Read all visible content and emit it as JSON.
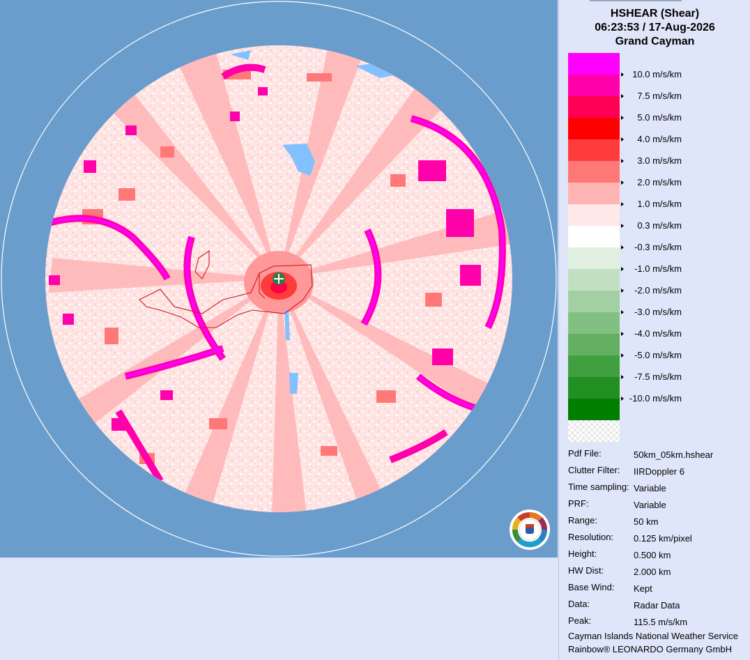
{
  "product": {
    "title": "HSHEAR (Shear)",
    "datetime": "06:23:53 / 17-Aug-2026",
    "site": "Grand Cayman"
  },
  "legend": [
    {
      "label": "10.0 m/s/km",
      "color": "#ff00ff"
    },
    {
      "label": "7.5 m/s/km",
      "color": "#ff00aa"
    },
    {
      "label": "5.0 m/s/km",
      "color": "#ff0055"
    },
    {
      "label": "4.0 m/s/km",
      "color": "#ff0000"
    },
    {
      "label": "3.0 m/s/km",
      "color": "#ff3c3c"
    },
    {
      "label": "2.0 m/s/km",
      "color": "#ff7878"
    },
    {
      "label": "1.0 m/s/km",
      "color": "#ffb4b4"
    },
    {
      "label": "0.3 m/s/km",
      "color": "#ffe8e8"
    },
    {
      "label": "-0.3 m/s/km",
      "color": "#ffffff"
    },
    {
      "label": "-1.0 m/s/km",
      "color": "#e0efe0"
    },
    {
      "label": "-2.0 m/s/km",
      "color": "#c1e0c1"
    },
    {
      "label": "-3.0 m/s/km",
      "color": "#a2d0a2"
    },
    {
      "label": "-4.0 m/s/km",
      "color": "#82c082"
    },
    {
      "label": "-5.0 m/s/km",
      "color": "#63b063"
    },
    {
      "label": "-7.5 m/s/km",
      "color": "#40a040"
    },
    {
      "label": "-10.0 m/s/km",
      "color": "#218f21"
    },
    {
      "label": "",
      "color": "#007f00"
    }
  ],
  "info": [
    {
      "key": "Pdf File:",
      "value": "50km_05km.hshear"
    },
    {
      "key": "Clutter Filter:",
      "value": "IIRDoppler 6"
    },
    {
      "key": "Time sampling:",
      "value": "Variable"
    },
    {
      "key": "PRF:",
      "value": "Variable"
    },
    {
      "key": "Range:",
      "value": "50 km"
    },
    {
      "key": "Resolution:",
      "value": "0.125 km/pixel"
    },
    {
      "key": "Height:",
      "value": "0.500 km"
    },
    {
      "key": "HW Dist:",
      "value": "2.000 km"
    },
    {
      "key": "Base Wind:",
      "value": "Kept"
    },
    {
      "key": "Data:",
      "value": "Radar Data"
    },
    {
      "key": "Peak:",
      "value": "115.5 m/s/km"
    }
  ],
  "footer": {
    "organization": "Cayman Islands National Weather Service",
    "software": "Rainbow® LEONARDO Germany GmbH"
  },
  "map": {
    "background_color": "#6a9ccc",
    "radar_site_icon": "plus-marker-icon",
    "logo_icon": "cayman-nws-logo-icon"
  }
}
